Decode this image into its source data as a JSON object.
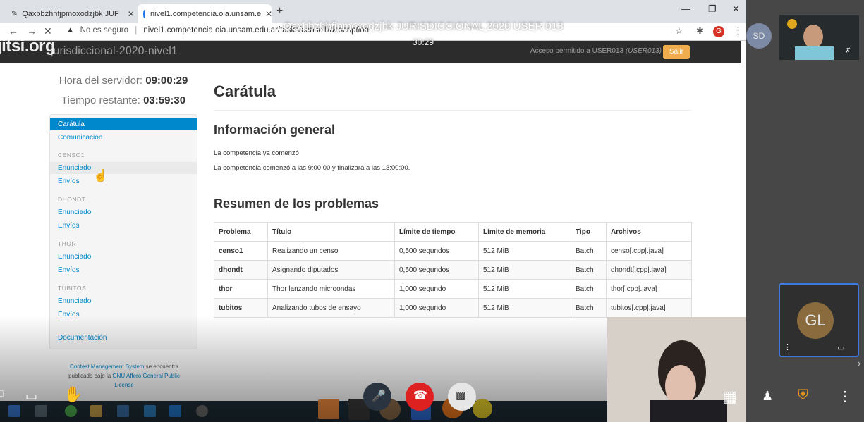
{
  "meeting": {
    "title": "Qaxbbzhhfjpmoxodzjbk JURISDICCIONAL 2020 USER 013",
    "timer": "30:29",
    "jitsi_logo": "jitsi.org"
  },
  "browser": {
    "tab1_title": "Qaxbbzhhfjpmoxodzjbk JUF",
    "tab2_title": "nivel1.competencia.oia.unsam.e",
    "insecure_label": "No es seguro",
    "url": "nivel1.competencia.oia.unsam.edu.ar/tasks/censo1/description",
    "ext_avatar": "G"
  },
  "cms": {
    "contest_name": "jurisdiccional-2020-nivel1",
    "access_text": "Acceso permitido a USER013",
    "access_user": "(USER013)",
    "logout_label": "Salir",
    "server_time_label": "Hora del servidor:",
    "server_time": "09:00:29",
    "remaining_label": "Tiempo restante:",
    "remaining": "03:59:30",
    "sidebar": {
      "overview": "Carátula",
      "communication": "Comunicación",
      "task1": "CENSO1",
      "task2": "DHONDT",
      "task3": "THOR",
      "task4": "TUBITOS",
      "statement": "Enunciado",
      "submissions": "Envíos",
      "docs": "Documentación"
    },
    "footer": {
      "l1_link": "Contest Management System",
      "l1_text": "se encuentra",
      "l2_text": "publicado bajo la",
      "l2_link": "GNU Affero General Public",
      "l3_link": "License"
    },
    "page_title": "Carátula",
    "general_title": "Información general",
    "general_p1": "La competencia ya comenzó",
    "general_p2": "La competencia comenzó a las 9:00:00 y finalizará a las 13:00:00.",
    "summary_title": "Resumen de los problemas",
    "table_headers": [
      "Problema",
      "Título",
      "Límite de tiempo",
      "Límite de memoria",
      "Tipo",
      "Archivos"
    ],
    "problems": [
      [
        "censo1",
        "Realizando un censo",
        "0,500 segundos",
        "512 MiB",
        "Batch",
        "censo[.cpp|.java]"
      ],
      [
        "dhondt",
        "Asignando diputados",
        "0,500 segundos",
        "512 MiB",
        "Batch",
        "dhondt[.cpp|.java]"
      ],
      [
        "thor",
        "Thor lanzando microondas",
        "1,000 segundo",
        "512 MiB",
        "Batch",
        "thor[.cpp|.java]"
      ],
      [
        "tubitos",
        "Analizando tubos de ensayo",
        "1,000 segundo",
        "512 MiB",
        "Batch",
        "tubitos[.cpp|.java]"
      ]
    ]
  },
  "participants": {
    "sd_initials": "SD",
    "gl_initials": "GL"
  },
  "colors": {
    "link": "#0088cc",
    "logout": "#f0ad4e",
    "cms_header": "#2c2c2c",
    "jitsi_hangup": "#dd2121"
  }
}
